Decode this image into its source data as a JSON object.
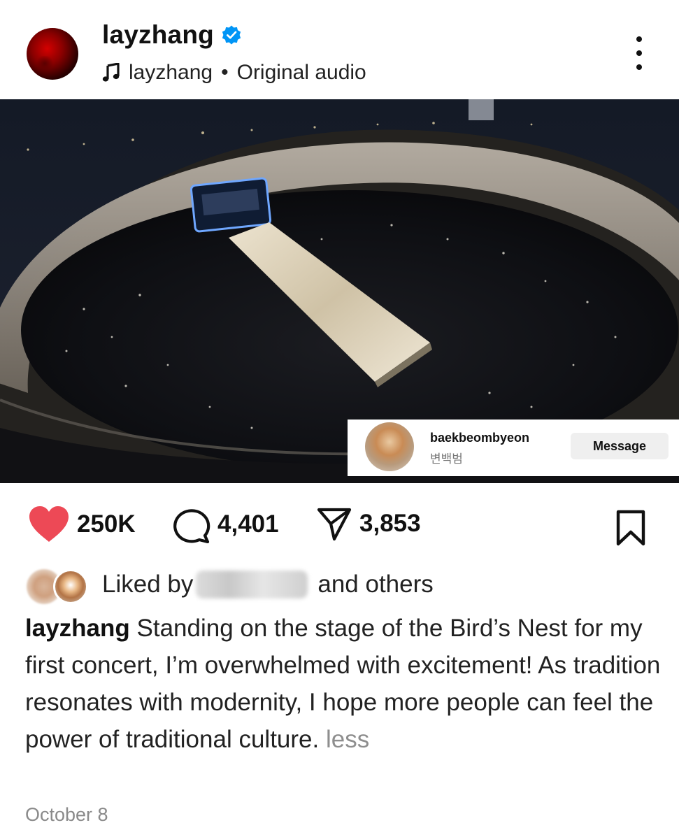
{
  "header": {
    "username": "layzhang",
    "audio_owner": "layzhang",
    "separator": "•",
    "audio_label": "Original audio"
  },
  "tagged_user": {
    "username": "baekbeombyeon",
    "display_name": "변백범",
    "button_label": "Message"
  },
  "actions": {
    "likes": "250K",
    "comments": "4,401",
    "shares": "3,853"
  },
  "liked_by": {
    "prefix": "Liked by",
    "suffix": "and others"
  },
  "caption": {
    "username": "layzhang",
    "text": "Standing on the stage of the Bird’s Nest for my first concert, I’m overwhelmed with excitement! As tradition resonates with modernity, I hope more people can feel the power of traditional culture.",
    "less_label": "less"
  },
  "date": "October 8",
  "colors": {
    "like": "#ed4956",
    "verified": "#0095f6",
    "muted": "#8e8e8e"
  }
}
